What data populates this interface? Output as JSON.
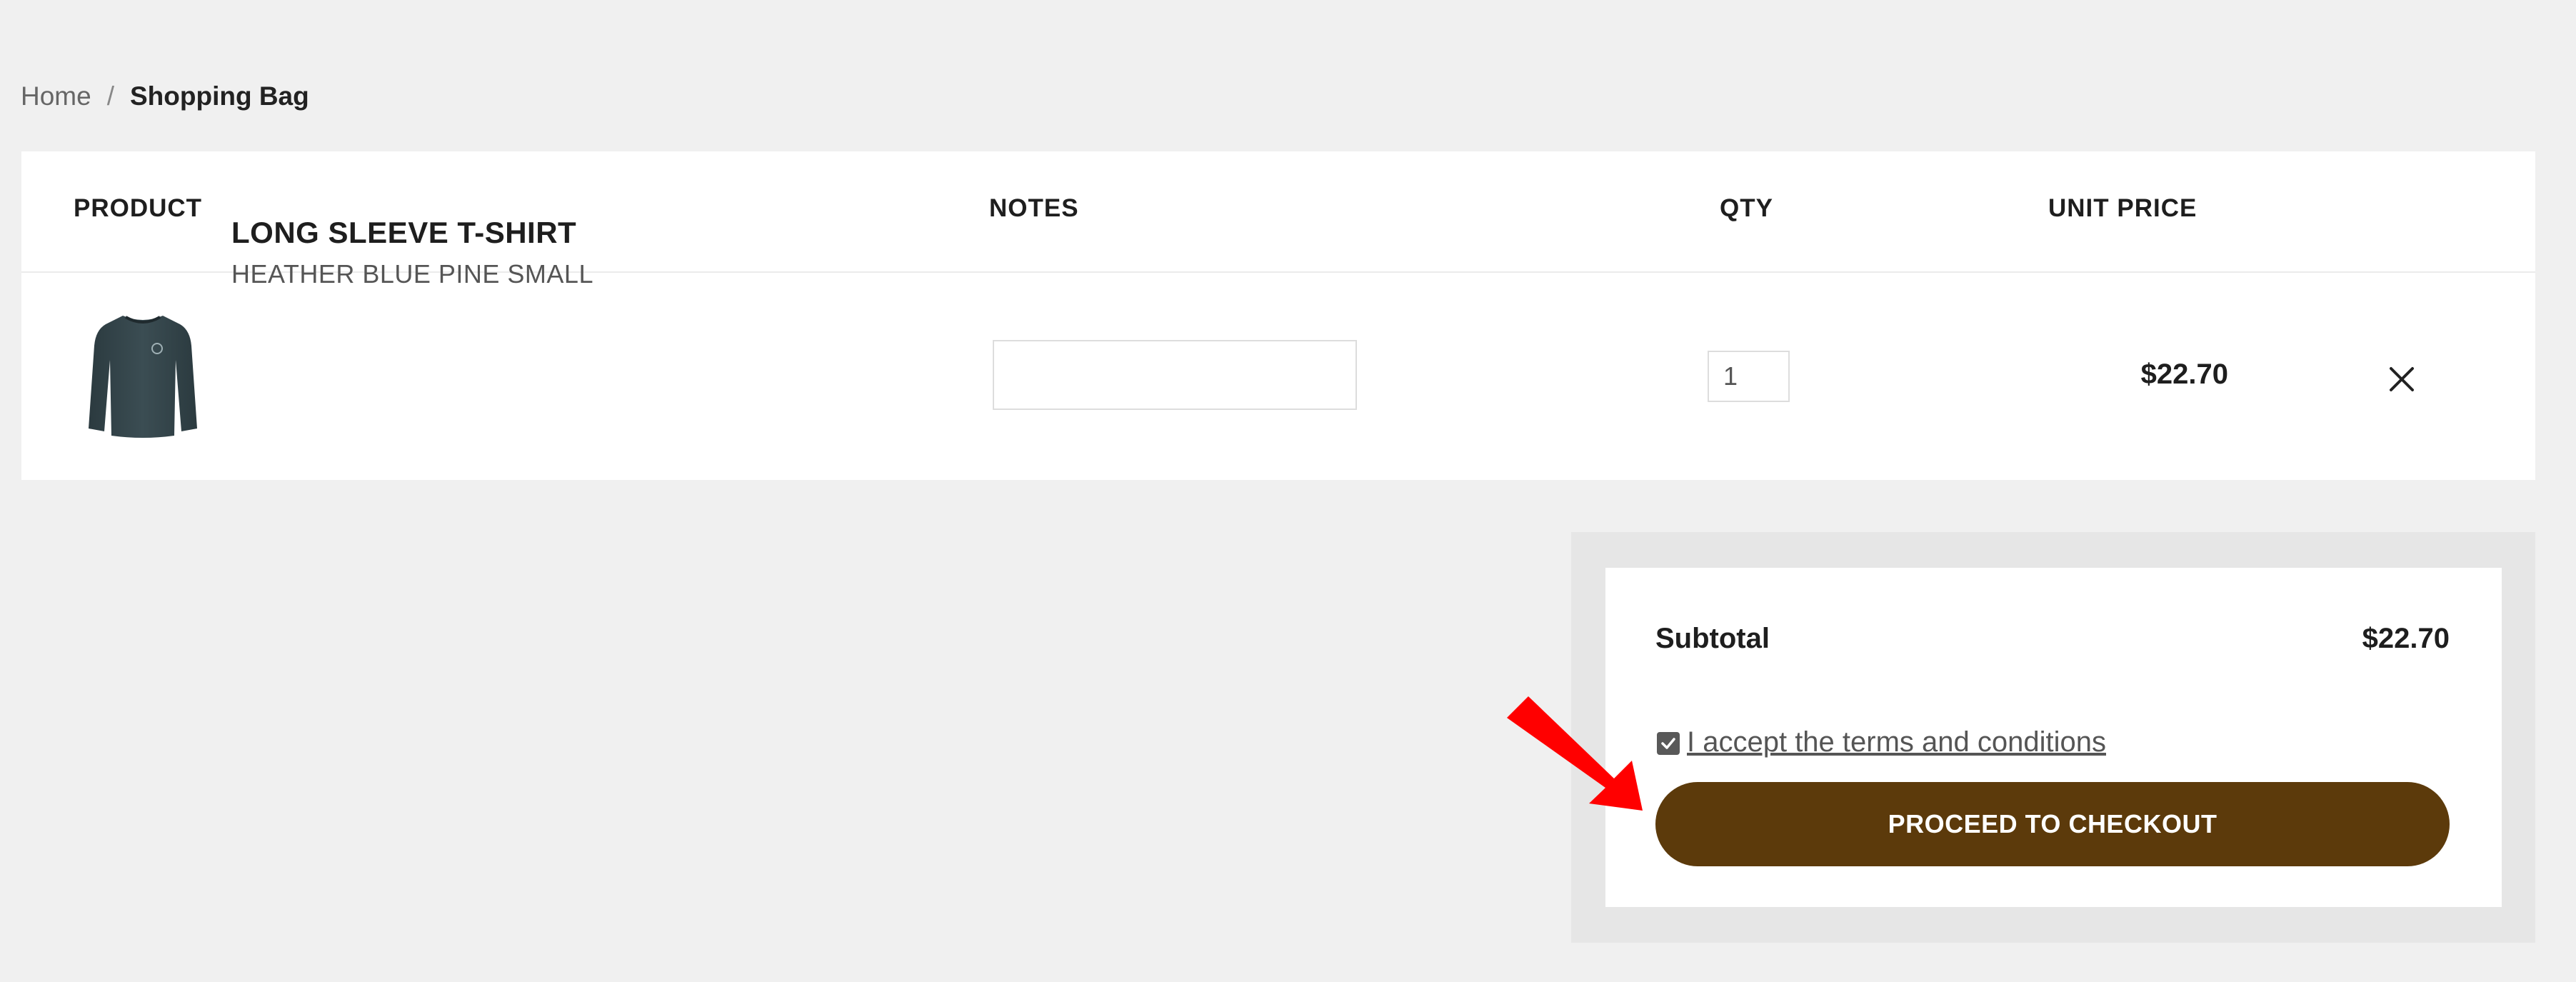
{
  "breadcrumb": {
    "home": "Home",
    "separator": "/",
    "current": "Shopping Bag"
  },
  "cart": {
    "columns": {
      "product": "PRODUCT",
      "notes": "NOTES",
      "qty": "QTY",
      "unit_price": "UNIT PRICE"
    },
    "items": [
      {
        "name": "LONG SLEEVE T-SHIRT",
        "variant": "HEATHER BLUE PINE SMALL",
        "notes_value": "",
        "qty": "1",
        "unit_price": "$22.70",
        "image_icon": "long-sleeve-shirt-icon",
        "remove_icon": "close-icon"
      }
    ]
  },
  "summary": {
    "subtotal_label": "Subtotal",
    "subtotal_value": "$22.70",
    "terms_checked": true,
    "terms_text": "I accept the terms and conditions",
    "checkout_label": "PROCEED TO CHECKOUT"
  },
  "colors": {
    "page_background": "#f0f0f0",
    "card_background": "#ffffff",
    "summary_outer": "#e6e6e6",
    "checkout_button": "#5c3a0b",
    "annotation_arrow": "#ff0000"
  }
}
